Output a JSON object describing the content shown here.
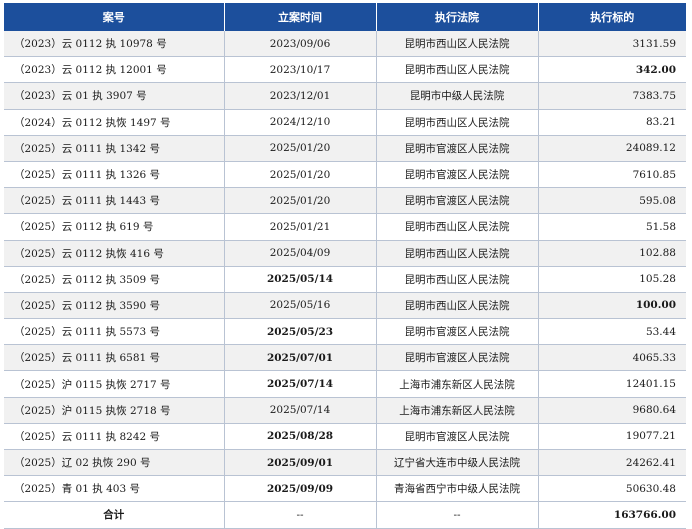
{
  "table": {
    "headers": [
      "案号",
      "立案时间",
      "执行法院",
      "执行标的"
    ],
    "rows": [
      {
        "case": "（2023）云 0112 执 10978 号",
        "date": "2023/09/06",
        "court": "昆明市西山区人民法院",
        "amount": "3131.59",
        "bold_amount": false,
        "bold_date": false
      },
      {
        "case": "（2023）云 0112 执 12001 号",
        "date": "2023/10/17",
        "court": "昆明市西山区人民法院",
        "amount": "342.00",
        "bold_amount": true,
        "bold_date": false
      },
      {
        "case": "（2023）云 01 执 3907 号",
        "date": "2023/12/01",
        "court": "昆明市中级人民法院",
        "amount": "7383.75",
        "bold_amount": false,
        "bold_date": false
      },
      {
        "case": "（2024）云 0112 执恢 1497 号",
        "date": "2024/12/10",
        "court": "昆明市西山区人民法院",
        "amount": "83.21",
        "bold_amount": false,
        "bold_date": false
      },
      {
        "case": "（2025）云 0111 执 1342 号",
        "date": "2025/01/20",
        "court": "昆明市官渡区人民法院",
        "amount": "24089.12",
        "bold_amount": false,
        "bold_date": false
      },
      {
        "case": "（2025）云 0111 执 1326 号",
        "date": "2025/01/20",
        "court": "昆明市官渡区人民法院",
        "amount": "7610.85",
        "bold_amount": false,
        "bold_date": false
      },
      {
        "case": "（2025）云 0111 执 1443 号",
        "date": "2025/01/20",
        "court": "昆明市官渡区人民法院",
        "amount": "595.08",
        "bold_amount": false,
        "bold_date": false
      },
      {
        "case": "（2025）云 0112 执 619 号",
        "date": "2025/01/21",
        "court": "昆明市西山区人民法院",
        "amount": "51.58",
        "bold_amount": false,
        "bold_date": false
      },
      {
        "case": "（2025）云 0112 执恢 416 号",
        "date": "2025/04/09",
        "court": "昆明市西山区人民法院",
        "amount": "102.88",
        "bold_amount": false,
        "bold_date": false
      },
      {
        "case": "（2025）云 0112 执 3509 号",
        "date": "2025/05/14",
        "court": "昆明市西山区人民法院",
        "amount": "105.28",
        "bold_amount": false,
        "bold_date": true
      },
      {
        "case": "（2025）云 0112 执 3590 号",
        "date": "2025/05/16",
        "court": "昆明市西山区人民法院",
        "amount": "100.00",
        "bold_amount": true,
        "bold_date": false
      },
      {
        "case": "（2025）云 0111 执 5573 号",
        "date": "2025/05/23",
        "court": "昆明市官渡区人民法院",
        "amount": "53.44",
        "bold_amount": false,
        "bold_date": true
      },
      {
        "case": "（2025）云 0111 执 6581 号",
        "date": "2025/07/01",
        "court": "昆明市官渡区人民法院",
        "amount": "4065.33",
        "bold_amount": false,
        "bold_date": true
      },
      {
        "case": "（2025）沪 0115 执恢 2717 号",
        "date": "2025/07/14",
        "court": "上海市浦东新区人民法院",
        "amount": "12401.15",
        "bold_amount": false,
        "bold_date": true
      },
      {
        "case": "（2025）沪 0115 执恢 2718 号",
        "date": "2025/07/14",
        "court": "上海市浦东新区人民法院",
        "amount": "9680.64",
        "bold_amount": false,
        "bold_date": false
      },
      {
        "case": "（2025）云 0111 执 8242 号",
        "date": "2025/08/28",
        "court": "昆明市官渡区人民法院",
        "amount": "19077.21",
        "bold_amount": false,
        "bold_date": true
      },
      {
        "case": "（2025）辽 02 执恢 290 号",
        "date": "2025/09/01",
        "court": "辽宁省大连市中级人民法院",
        "amount": "24262.41",
        "bold_amount": false,
        "bold_date": true
      },
      {
        "case": "（2025）青 01 执 403 号",
        "date": "2025/09/09",
        "court": "青海省西宁市中级人民法院",
        "amount": "50630.48",
        "bold_amount": false,
        "bold_date": true
      }
    ],
    "total": {
      "label": "合计",
      "date": "--",
      "court": "--",
      "amount": "163766.00"
    }
  }
}
